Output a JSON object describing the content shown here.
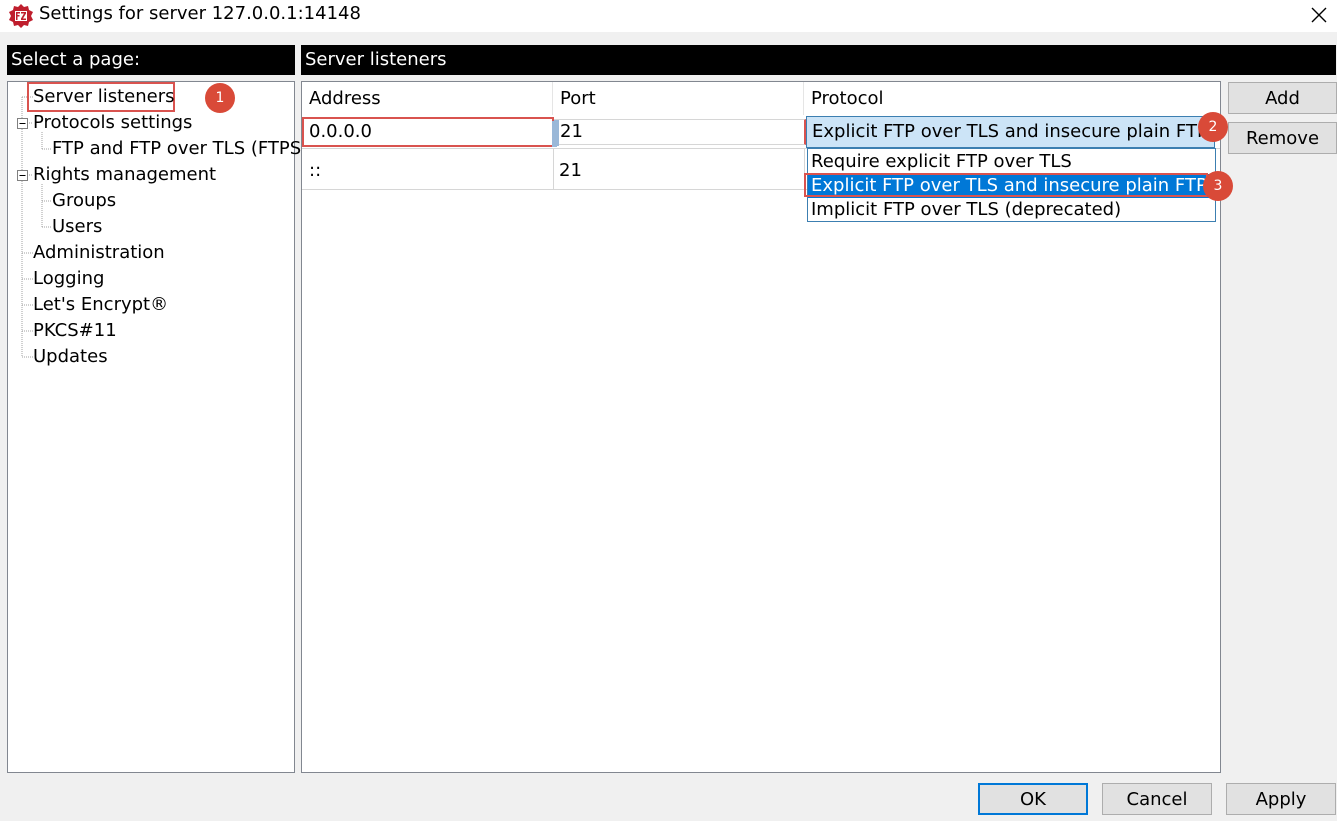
{
  "window": {
    "title": "Settings for server 127.0.0.1:14148",
    "accent_color": "#0078d7",
    "annotation_color": "#d94a38"
  },
  "left_panel": {
    "header": "Select a page:",
    "tree": [
      {
        "label": "Server listeners",
        "level": 0
      },
      {
        "label": "Protocols settings",
        "level": 0,
        "expanded": true
      },
      {
        "label": "FTP and FTP over TLS (FTPS)",
        "level": 1
      },
      {
        "label": "Rights management",
        "level": 0,
        "expanded": true
      },
      {
        "label": "Groups",
        "level": 1
      },
      {
        "label": "Users",
        "level": 1
      },
      {
        "label": "Administration",
        "level": 0
      },
      {
        "label": "Logging",
        "level": 0
      },
      {
        "label": "Let's Encrypt®",
        "level": 0
      },
      {
        "label": "PKCS#11",
        "level": 0
      },
      {
        "label": "Updates",
        "level": 0
      }
    ]
  },
  "right_panel": {
    "header": "Server listeners",
    "columns": [
      "Address",
      "Port",
      "Protocol"
    ],
    "rows": [
      {
        "address": "0.0.0.0",
        "port": "21",
        "protocol": "Explicit FTP over TLS and insecure plain FTP"
      },
      {
        "address": "::",
        "port": "21",
        "protocol": ""
      }
    ],
    "protocol_options": [
      "Require explicit FTP over TLS",
      "Explicit FTP over TLS and insecure plain FTP",
      "Implicit FTP over TLS (deprecated)"
    ],
    "selected_option": "Explicit FTP over TLS and insecure plain FTP"
  },
  "side_buttons": {
    "add": "Add",
    "remove": "Remove"
  },
  "footer_buttons": {
    "ok": "OK",
    "cancel": "Cancel",
    "apply": "Apply"
  },
  "annotations": [
    "1",
    "2",
    "3"
  ]
}
